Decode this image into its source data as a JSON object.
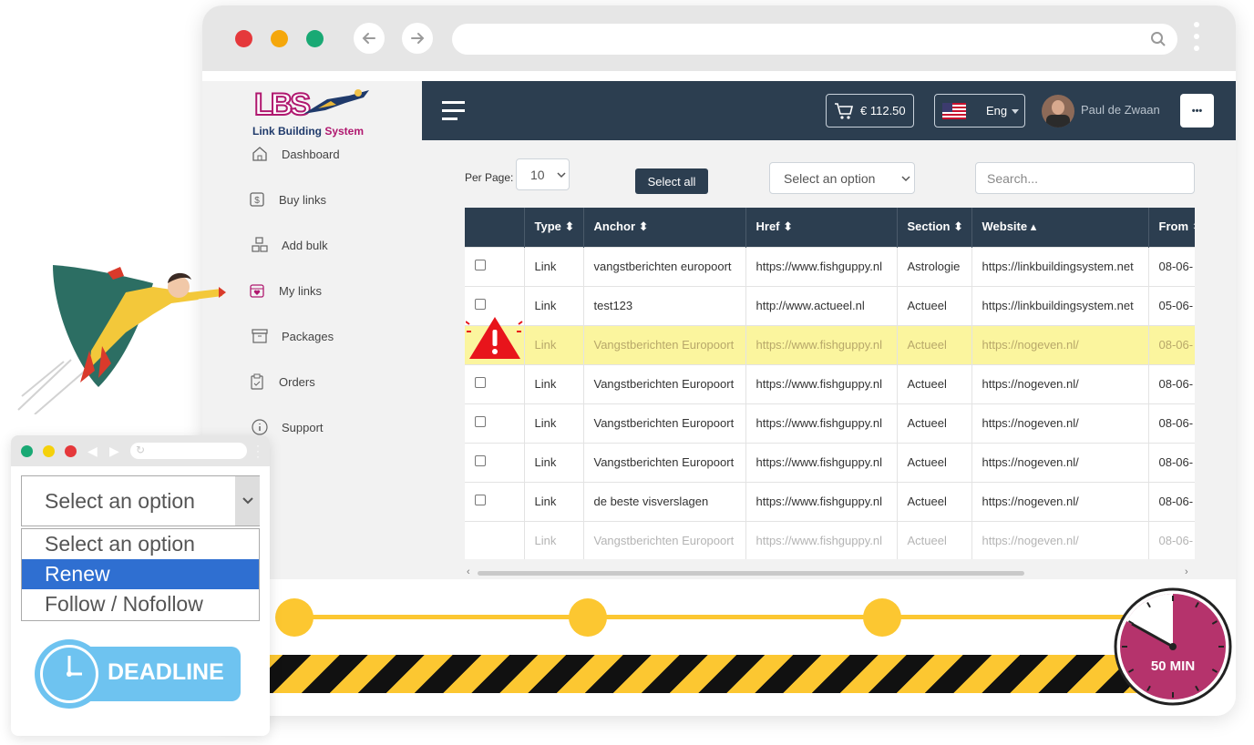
{
  "app": {
    "logo_text_1": "Link Building ",
    "logo_text_2": "System",
    "logo_letters": "LBS"
  },
  "sidebar": {
    "items": [
      {
        "label": "Dashboard",
        "icon": "home-icon"
      },
      {
        "label": "Buy links",
        "icon": "dollar-doc-icon"
      },
      {
        "label": "Add bulk",
        "icon": "boxes-icon"
      },
      {
        "label": "My links",
        "icon": "calendar-heart-icon"
      },
      {
        "label": "Packages",
        "icon": "archive-icon"
      },
      {
        "label": "Orders",
        "icon": "clipboard-icon"
      },
      {
        "label": "Support",
        "icon": "info-icon"
      }
    ]
  },
  "topbar": {
    "cart_amount": "€ 112.50",
    "language": "Eng",
    "user_name": "Paul de Zwaan",
    "more_label": "•••"
  },
  "controls": {
    "per_page_label": "Per Page:",
    "per_page_value": "10",
    "select_all_label": "Select all",
    "action_select": "Select an option",
    "search_placeholder": "Search..."
  },
  "table": {
    "headers": [
      "",
      "Type",
      "Anchor",
      "Href",
      "Section",
      "Website",
      "From"
    ],
    "sorted_column": "Website",
    "rows": [
      {
        "type": "Link",
        "anchor": "vangstberichten europoort",
        "href": "https://www.fishguppy.nl",
        "section": "Astrologie",
        "website": "https://linkbuildingsystem.net",
        "from": "08-06-",
        "state": "normal"
      },
      {
        "type": "Link",
        "anchor": "test123",
        "href": "http://www.actueel.nl",
        "section": "Actueel",
        "website": "https://linkbuildingsystem.net",
        "from": "05-06-",
        "state": "normal"
      },
      {
        "type": "Link",
        "anchor": "Vangstberichten Europoort",
        "href": "https://www.fishguppy.nl",
        "section": "Actueel",
        "website": "https://nogeven.nl/",
        "from": "08-06-",
        "state": "warning"
      },
      {
        "type": "Link",
        "anchor": "Vangstberichten Europoort",
        "href": "https://www.fishguppy.nl",
        "section": "Actueel",
        "website": "https://nogeven.nl/",
        "from": "08-06-",
        "state": "normal"
      },
      {
        "type": "Link",
        "anchor": "Vangstberichten Europoort",
        "href": "https://www.fishguppy.nl",
        "section": "Actueel",
        "website": "https://nogeven.nl/",
        "from": "08-06-",
        "state": "normal"
      },
      {
        "type": "Link",
        "anchor": "Vangstberichten Europoort",
        "href": "https://www.fishguppy.nl",
        "section": "Actueel",
        "website": "https://nogeven.nl/",
        "from": "08-06-",
        "state": "normal"
      },
      {
        "type": "Link",
        "anchor": "de beste visverslagen",
        "href": "https://www.fishguppy.nl",
        "section": "Actueel",
        "website": "https://nogeven.nl/",
        "from": "08-06-",
        "state": "normal"
      },
      {
        "type": "Link",
        "anchor": "Vangstberichten Europoort",
        "href": "https://www.fishguppy.nl",
        "section": "Actueel",
        "website": "https://nogeven.nl/",
        "from": "08-06-",
        "state": "faded"
      }
    ]
  },
  "dropdown": {
    "selected": "Select an option",
    "options": [
      "Select an option",
      "Renew",
      "Follow / Nofollow"
    ],
    "highlighted": "Renew"
  },
  "deadline": {
    "label": "DEADLINE",
    "timer_label": "50 MIN",
    "timer_fraction": 0.17
  },
  "colors": {
    "navy": "#2c3e50",
    "highlight": "#fbf59e",
    "accent_blue": "#2f6fd1",
    "timer": "#b5336c",
    "warning_red": "#e8141b",
    "progress_yellow": "#fcc731"
  }
}
